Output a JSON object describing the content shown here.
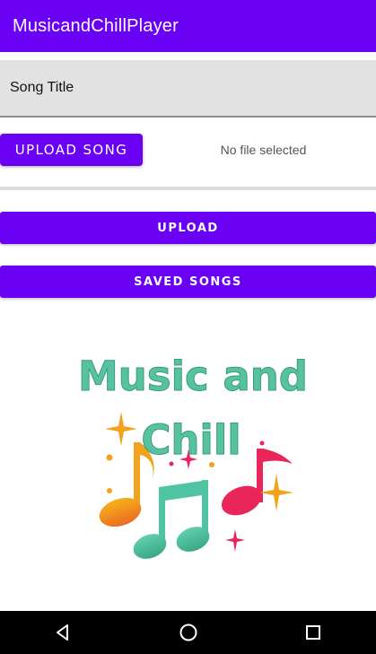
{
  "app": {
    "title": "MusicandChillPlayer"
  },
  "song_title": {
    "placeholder": "Song Title",
    "value": ""
  },
  "upload_song_button": {
    "label": "UPLOAD SONG"
  },
  "file_status": "No file selected",
  "upload_button": {
    "label": "UPLOAD"
  },
  "saved_songs_button": {
    "label": "SAVED SONGS"
  },
  "logo": {
    "line1": "Music and",
    "line2": "Chill",
    "text_color": "#57c2a0"
  },
  "colors": {
    "accent": "#6a00f4",
    "field_bg": "#e2e2e2",
    "navbar": "#000000"
  },
  "nav": {
    "back_icon": "back-icon",
    "home_icon": "home-icon",
    "recents_icon": "recents-icon"
  }
}
